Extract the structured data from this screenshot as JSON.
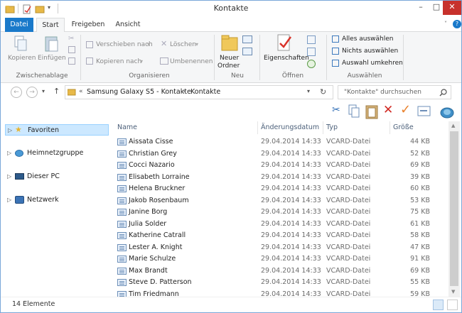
{
  "window": {
    "title": "Kontakte",
    "minimize": "–",
    "maximize": "□",
    "close": "✕"
  },
  "ribbon_tabs": [
    {
      "label": "Datei"
    },
    {
      "label": "Start"
    },
    {
      "label": "Freigeben"
    },
    {
      "label": "Ansicht"
    }
  ],
  "ribbon": {
    "clipboard": {
      "copy": "Kopieren",
      "paste": "Einfügen",
      "group": "Zwischenablage"
    },
    "organize": {
      "move": "Verschieben nach",
      "copy_to": "Kopieren nach",
      "delete": "Löschen",
      "rename": "Umbenennen",
      "group": "Organisieren"
    },
    "new": {
      "new_folder": "Neuer Ordner",
      "new_folder_l1": "Neuer",
      "new_folder_l2": "Ordner",
      "group": "Neu"
    },
    "open": {
      "properties": "Eigenschaften",
      "group": "Öffnen"
    },
    "select": {
      "select_all": "Alles auswählen",
      "select_none": "Nichts auswählen",
      "invert": "Auswahl umkehren",
      "group": "Auswählen"
    }
  },
  "address": {
    "prefix": "«",
    "crumbs": [
      "Samsung Galaxy S5 - Kontakte",
      "Kontakte"
    ],
    "separator": "›",
    "search_placeholder": "\"Kontakte\" durchsuchen"
  },
  "nav_pane": [
    {
      "label": "Favoriten",
      "icon": "star-icon"
    },
    {
      "label": "Heimnetzgruppe",
      "icon": "homegroup-icon"
    },
    {
      "label": "Dieser PC",
      "icon": "computer-icon"
    },
    {
      "label": "Netzwerk",
      "icon": "network-icon"
    }
  ],
  "columns": [
    "Name",
    "Änderungsdatum",
    "Typ",
    "Größe"
  ],
  "files": [
    {
      "name": "Aissata Cisse",
      "date": "29.04.2014 14:33",
      "type": "VCARD-Datei",
      "size": "44 KB"
    },
    {
      "name": "Christian Grey",
      "date": "29.04.2014 14:33",
      "type": "VCARD-Datei",
      "size": "52 KB"
    },
    {
      "name": "Cocci Nazario",
      "date": "29.04.2014 14:33",
      "type": "VCARD-Datei",
      "size": "69 KB"
    },
    {
      "name": "Elisabeth Lorraine",
      "date": "29.04.2014 14:33",
      "type": "VCARD-Datei",
      "size": "39 KB"
    },
    {
      "name": "Helena Bruckner",
      "date": "29.04.2014 14:33",
      "type": "VCARD-Datei",
      "size": "60 KB"
    },
    {
      "name": "Jakob Rosenbaum",
      "date": "29.04.2014 14:33",
      "type": "VCARD-Datei",
      "size": "53 KB"
    },
    {
      "name": "Janine Borg",
      "date": "29.04.2014 14:33",
      "type": "VCARD-Datei",
      "size": "75 KB"
    },
    {
      "name": "Julia Solder",
      "date": "29.04.2014 14:33",
      "type": "VCARD-Datei",
      "size": "61 KB"
    },
    {
      "name": "Katherine Catrall",
      "date": "29.04.2014 14:33",
      "type": "VCARD-Datei",
      "size": "58 KB"
    },
    {
      "name": "Lester A. Knight",
      "date": "29.04.2014 14:33",
      "type": "VCARD-Datei",
      "size": "47 KB"
    },
    {
      "name": "Marie Schulze",
      "date": "29.04.2014 14:33",
      "type": "VCARD-Datei",
      "size": "91 KB"
    },
    {
      "name": "Max Brandt",
      "date": "29.04.2014 14:33",
      "type": "VCARD-Datei",
      "size": "69 KB"
    },
    {
      "name": "Steve D. Patterson",
      "date": "29.04.2014 14:33",
      "type": "VCARD-Datei",
      "size": "55 KB"
    },
    {
      "name": "Tim Friedmann",
      "date": "29.04.2014 14:33",
      "type": "VCARD-Datei",
      "size": "59 KB"
    }
  ],
  "status": {
    "count": "14 Elemente"
  },
  "colors": {
    "accent": "#1979ca",
    "selection": "#cce8ff",
    "close": "#c7312c"
  }
}
